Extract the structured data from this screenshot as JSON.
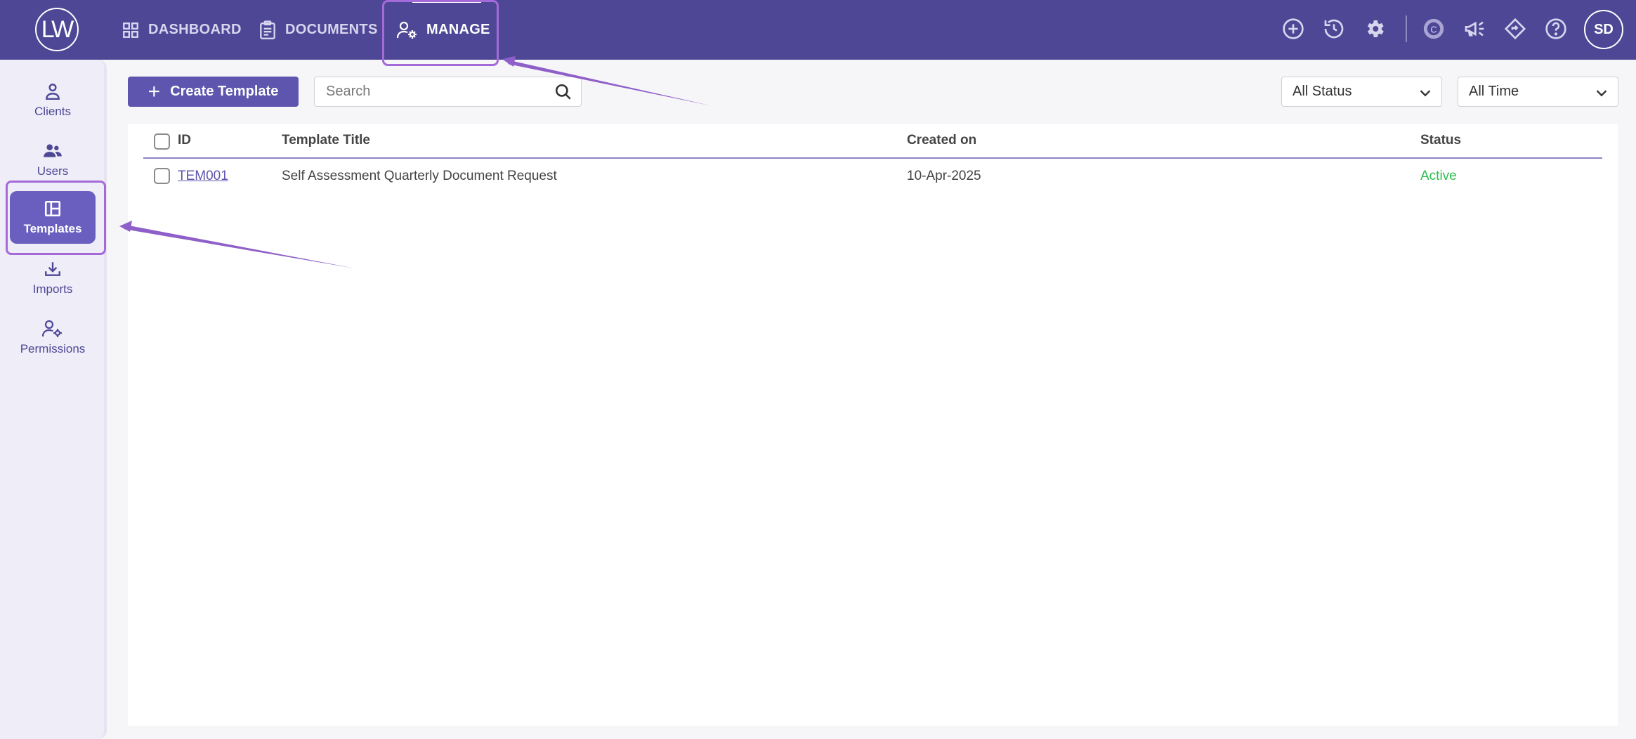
{
  "app": {
    "logo_text": "LW",
    "nav": [
      {
        "label": "DASHBOARD",
        "icon": "grid-icon"
      },
      {
        "label": "DOCUMENTS",
        "icon": "clipboard-icon"
      },
      {
        "label": "MANAGE",
        "icon": "user-gear-icon",
        "active": true
      }
    ],
    "top_icons": [
      "plus-circle-icon",
      "history-icon",
      "gear-icon",
      "c-logo-icon",
      "megaphone-icon",
      "diamond-icon",
      "help-icon"
    ],
    "avatar_initials": "SD"
  },
  "sidebar": {
    "items": [
      {
        "label": "Clients",
        "icon": "user-icon"
      },
      {
        "label": "Users",
        "icon": "users-icon"
      },
      {
        "label": "Templates",
        "icon": "template-icon",
        "active": true
      },
      {
        "label": "Imports",
        "icon": "download-icon"
      },
      {
        "label": "Permissions",
        "icon": "user-gear-icon"
      }
    ]
  },
  "toolbar": {
    "create_label": "Create Template",
    "search_placeholder": "Search",
    "status_filter": "All Status",
    "time_filter": "All Time"
  },
  "table": {
    "columns": [
      "ID",
      "Template Title",
      "Created on",
      "Status"
    ],
    "rows": [
      {
        "id": "TEM001",
        "title": "Self Assessment Quarterly Document Request",
        "created": "10-Apr-2025",
        "status": "Active"
      }
    ]
  },
  "colors": {
    "header_bg": "#4e4795",
    "accent": "#5d55ae",
    "annotation": "#a46ad9",
    "status_active": "#2ebf4f"
  }
}
